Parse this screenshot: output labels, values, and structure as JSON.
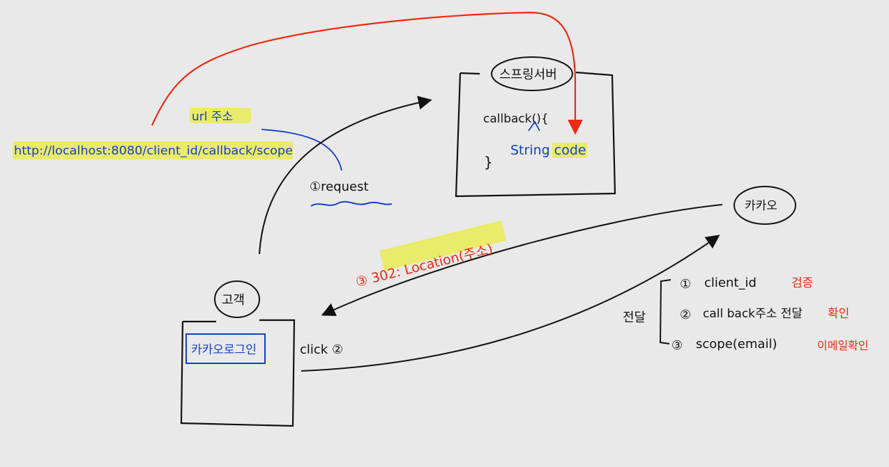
{
  "labels": {
    "url_title": "url 주소",
    "url": "http://localhost:8080/client_id/callback/scope",
    "request": "①request",
    "server_title": "스프링서버",
    "callback": "callback(){",
    "string_code": "String code",
    "close_brace": "}",
    "kakao": "카카오",
    "location": "③ 302: Location(주소)",
    "customer": "고객",
    "kakao_login": "카카오로그인",
    "click": "click ②",
    "transfer": "전달",
    "list": [
      {
        "num": "①",
        "text": "client_id",
        "note": "검증"
      },
      {
        "num": "②",
        "text": "call back주소 전달",
        "note": "확인"
      },
      {
        "num": "③",
        "text": "scope(email)",
        "note": "이메일확인"
      }
    ]
  },
  "colors": {
    "background": "#e9e9e9",
    "ink": "#111111",
    "blue": "#1440c8",
    "red": "#ee2a12",
    "highlight": "#eaea55"
  }
}
